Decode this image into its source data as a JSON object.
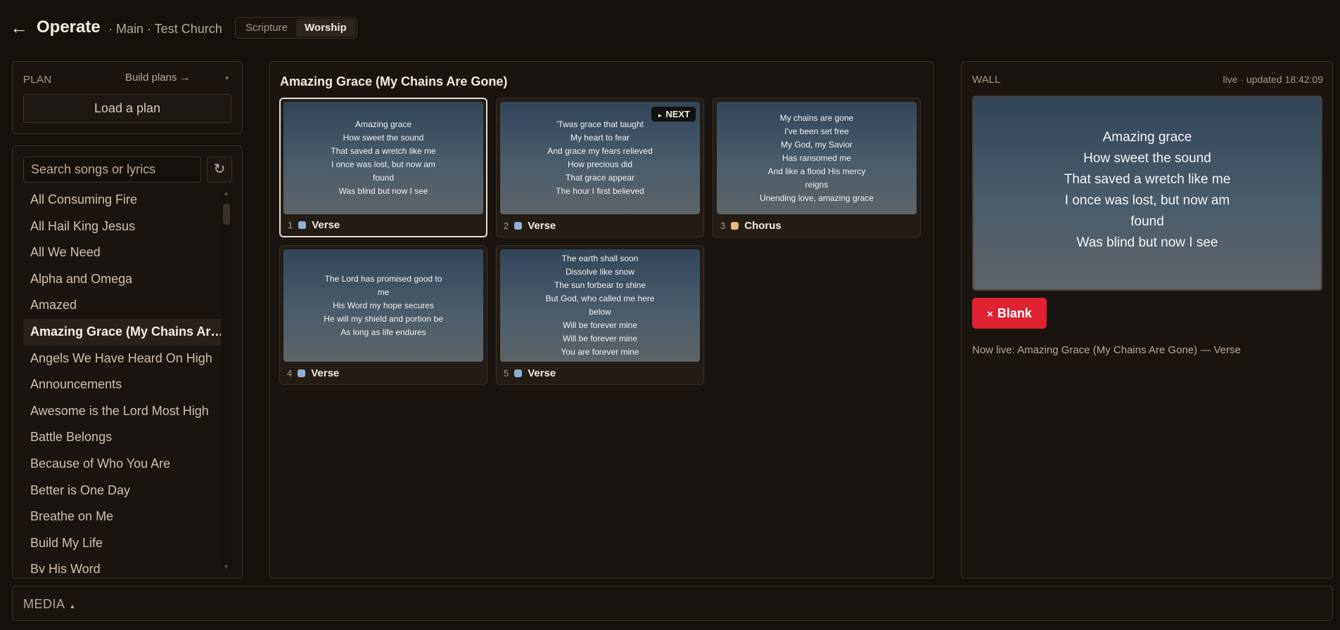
{
  "header": {
    "back_icon": "←",
    "title": "Operate",
    "context": "· Main · Test Church",
    "modes": [
      "Scripture",
      "Worship"
    ],
    "active_mode": "Worship"
  },
  "plan": {
    "label": "PLAN",
    "build_plans": "Build plans →",
    "caret": "▾",
    "load_button": "Load a plan"
  },
  "songs": {
    "search_placeholder": "Search songs or lyrics",
    "refresh_icon": "↻",
    "scroll_up": "▲",
    "scroll_down": "▼",
    "items": [
      "All Consuming Fire",
      "All Hail King Jesus",
      "All We Need",
      "Alpha and Omega",
      "Amazed",
      "Amazing Grace (My Chains Are Gone)",
      "Angels We Have Heard On High",
      "Announcements",
      "Awesome is the Lord Most High",
      "Battle Belongs",
      "Because of Who You Are",
      "Better is One Day",
      "Breathe on Me",
      "Build My Life",
      "By His Word"
    ],
    "selected": "Amazing Grace (My Chains Are Gone)"
  },
  "slides": {
    "song_title": "Amazing Grace (My Chains Are Gone)",
    "next_badge": "NEXT",
    "next_icon": "►",
    "colors": {
      "verse": "#8fb0d8",
      "chorus": "#e9b877"
    },
    "items": [
      {
        "num": "1",
        "label": "Verse",
        "kind": "verse",
        "live": true,
        "next": false,
        "lines": [
          "Amazing grace",
          "How sweet the sound",
          "That saved a wretch like me",
          "I once was lost, but now am",
          "found",
          "Was blind but now I see"
        ]
      },
      {
        "num": "2",
        "label": "Verse",
        "kind": "verse",
        "live": false,
        "next": true,
        "lines": [
          "'Twas grace that taught",
          "My heart to fear",
          "And grace my fears relieved",
          "How precious did",
          "That grace appear",
          "The hour I first believed"
        ]
      },
      {
        "num": "3",
        "label": "Chorus",
        "kind": "chorus",
        "live": false,
        "next": false,
        "lines": [
          "My chains are gone",
          "I've been set free",
          "My God, my Savior",
          "Has ransomed me",
          "And like a flood His mercy",
          "reigns",
          "Unending love, amazing grace"
        ]
      },
      {
        "num": "4",
        "label": "Verse",
        "kind": "verse",
        "live": false,
        "next": false,
        "lines": [
          "The Lord has promised good to",
          "me",
          "His Word my hope secures",
          "He will my shield and portion be",
          "As long as life endures"
        ]
      },
      {
        "num": "5",
        "label": "Verse",
        "kind": "verse",
        "live": false,
        "next": false,
        "lines": [
          "The earth shall soon",
          "Dissolve like snow",
          "The sun forbear to shine",
          "But God, who called me here",
          "below",
          "Will be forever mine",
          "Will be forever mine",
          "You are forever mine"
        ]
      }
    ]
  },
  "wall": {
    "label": "WALL",
    "status": "live · updated 18:42:09",
    "lines": [
      "Amazing grace",
      "How sweet the sound",
      "That saved a wretch like me",
      "I once was lost, but now am",
      "found",
      "Was blind but now I see"
    ],
    "blank_icon": "×",
    "blank_label": "Blank",
    "now_live": "Now live: Amazing Grace (My Chains Are Gone) — Verse"
  },
  "media": {
    "label": "MEDIA",
    "caret": "▲"
  }
}
